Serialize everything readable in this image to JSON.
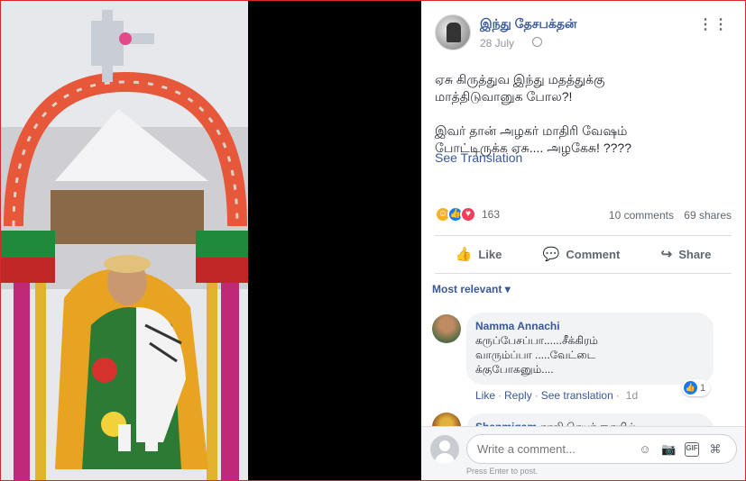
{
  "post": {
    "page_name": "இந்து தேசபக்தன்",
    "date": "28 July",
    "more_icon": "more-dots-icon",
    "text_lines": [
      "ஏசு கிருத்துவ இந்து மதத்துக்கு",
      "மாத்திடுவானுக போல?!",
      "இவர் தான் அழகர் மாதிரி வேஷம்",
      "போட்டிருக்க ஏசு.... அழகேசு! ????"
    ],
    "see_translation": "See Translation",
    "reaction_count": "163",
    "comments_count": "10 comments",
    "shares_count": "69 shares"
  },
  "actions": {
    "like": "Like",
    "comment": "Comment",
    "share": "Share"
  },
  "comments_filter": "Most relevant",
  "comments": [
    {
      "name": "Namma Annachi",
      "text": "கருப்பேசப்பா......சீக்கிரம் வாரும்ப்பா .....வேட்டை க்குபோகனும்....",
      "like": "Like",
      "reply": "Reply",
      "see_translation": "See translation",
      "time": "1d",
      "likes": "1"
    },
    {
      "name": "Shanmigam",
      "text": "தாலி செயர் கையில்"
    }
  ],
  "composer": {
    "placeholder": "Write a comment...",
    "hint": "Press Enter to post.",
    "gif_label": "GIF"
  },
  "colors": {
    "link": "#385898",
    "frame": "#d62a2a"
  }
}
